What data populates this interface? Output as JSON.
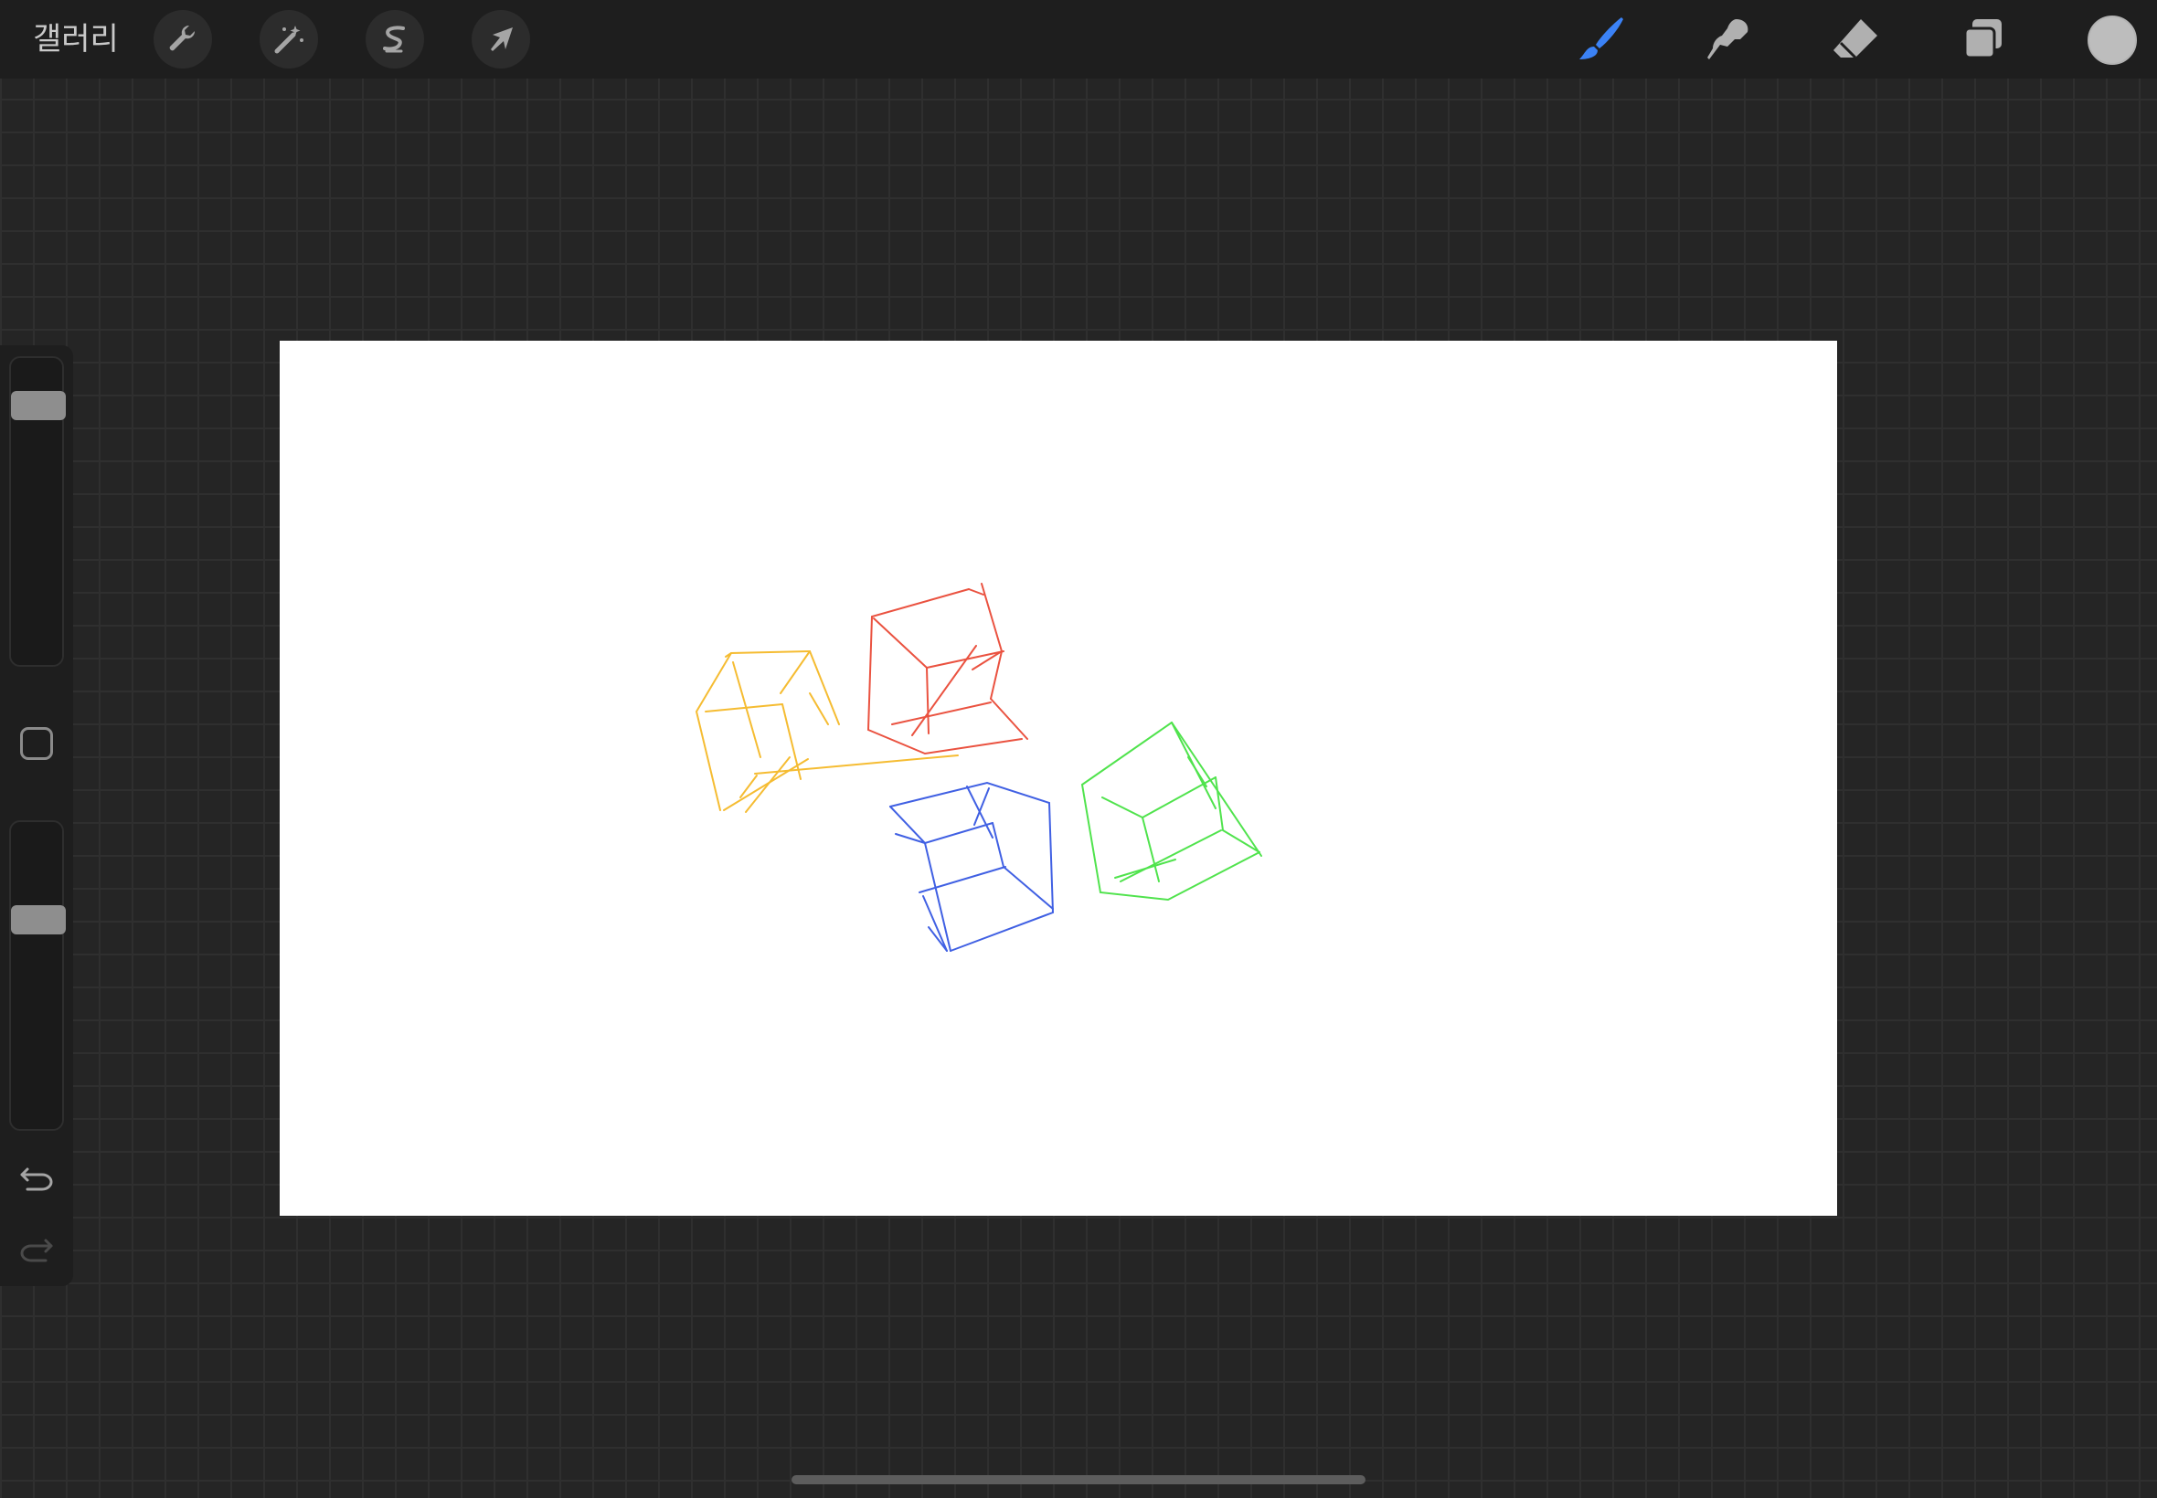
{
  "topbar": {
    "gallery_label": "갤러리",
    "left_tools": [
      {
        "name": "actions",
        "icon": "wrench-icon"
      },
      {
        "name": "adjustments",
        "icon": "magic-wand-icon"
      },
      {
        "name": "selection",
        "icon": "selection-s-icon"
      },
      {
        "name": "transform",
        "icon": "arrow-cursor-icon"
      }
    ],
    "right_tools": [
      {
        "name": "brush",
        "icon": "brush-icon",
        "active": true
      },
      {
        "name": "smudge",
        "icon": "smudge-icon",
        "active": false
      },
      {
        "name": "eraser",
        "icon": "eraser-icon",
        "active": false
      },
      {
        "name": "layers",
        "icon": "layers-icon",
        "active": false
      }
    ],
    "current_color": "#bdbdbd",
    "active_color": "#3b82f6"
  },
  "sidebar": {
    "brush_size_level": 0.12,
    "opacity_level": 0.3,
    "icons": [
      "modify-square-icon",
      "undo-icon",
      "redo-icon"
    ]
  },
  "canvas": {
    "background": "#ffffff",
    "cubes": [
      {
        "color": "#f5b51c"
      },
      {
        "color": "#e8402c"
      },
      {
        "color": "#2c4fe0"
      },
      {
        "color": "#3ee03a"
      }
    ]
  }
}
